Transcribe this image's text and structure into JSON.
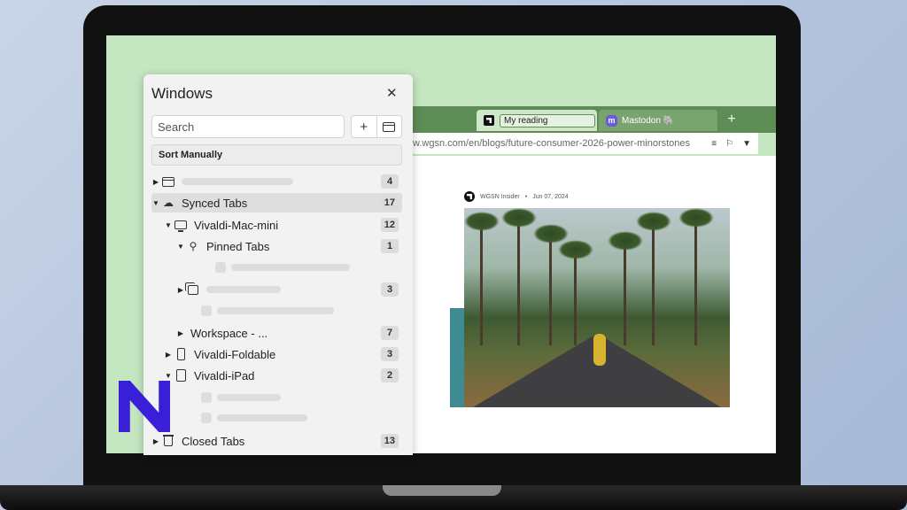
{
  "browser": {
    "tabs": [
      {
        "title": "My reading",
        "icon": "newspaper-logo-icon",
        "active": true
      },
      {
        "title": "Mastodon 🐘",
        "icon": "mastodon-icon",
        "active": false
      }
    ],
    "new_tab_symbol": "+",
    "url": "w.wgsn.com/en/blogs/future-consumer-2026-power-minorstones",
    "article": {
      "source": "WGSN Insider",
      "separator": "•",
      "date": "Jun 07, 2024"
    }
  },
  "windows_panel": {
    "title": "Windows",
    "close_symbol": "✕",
    "search_placeholder": "Search",
    "add_symbol": "+",
    "sort_label": "Sort Manually",
    "rows": [
      {
        "label": "",
        "count": "4"
      },
      {
        "label": "Synced Tabs",
        "count": "17"
      },
      {
        "label": "Vivaldi-Mac-mini",
        "count": "12"
      },
      {
        "label": "Pinned Tabs",
        "count": "1"
      },
      {
        "label": "",
        "count": "3"
      },
      {
        "label": "Workspace - ...",
        "count": "7"
      },
      {
        "label": "Vivaldi-Foldable",
        "count": "3"
      },
      {
        "label": "Vivaldi-iPad",
        "count": "2"
      },
      {
        "label": "Closed Tabs",
        "count": "13"
      }
    ]
  },
  "colors": {
    "tab_bar": "#5e8c55",
    "screen_background": "#c4e6c0",
    "logo_blue": "#3a1fd8"
  }
}
